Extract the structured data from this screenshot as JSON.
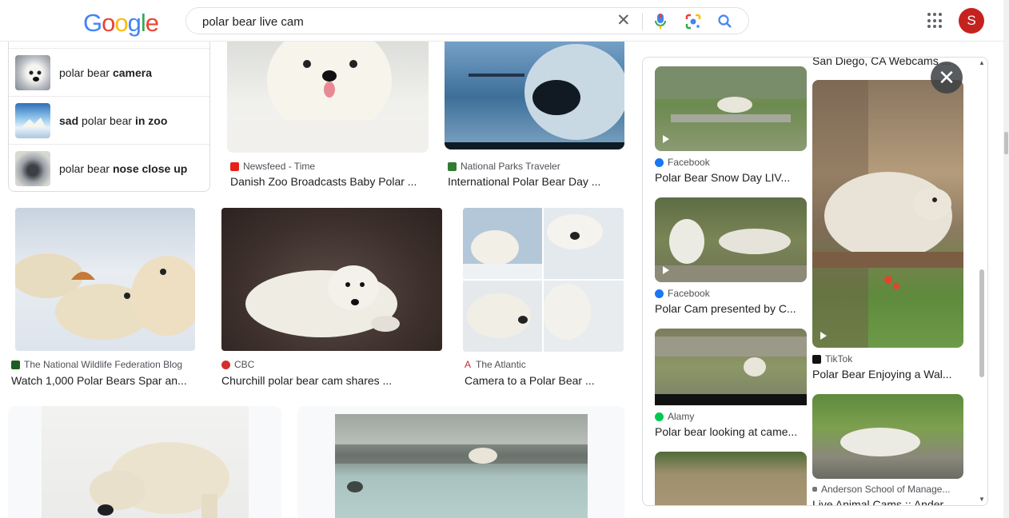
{
  "header": {
    "logo": "Google",
    "query": "polar bear live cam",
    "avatar_letter": "S",
    "icons": [
      "clear-icon",
      "mic-icon",
      "lens-icon",
      "search-icon",
      "apps-icon"
    ]
  },
  "related_searches": [
    {
      "prefix": "polar bear ",
      "bold": "camera",
      "suffix": ""
    },
    {
      "prefix": "",
      "bold": "sad",
      "suffix": " polar bear ",
      "bold2": "in zoo"
    },
    {
      "prefix": "polar bear ",
      "bold": "nose close up",
      "suffix": ""
    }
  ],
  "results": [
    {
      "source": "Newsfeed - Time",
      "title": "Danish Zoo Broadcasts Baby Polar ...",
      "fav_color": "#e62117"
    },
    {
      "source": "National Parks Traveler",
      "title": "International Polar Bear Day ...",
      "fav_color": "#2e7d32"
    },
    {
      "source": "The National Wildlife Federation Blog",
      "title": "Watch 1,000 Polar Bears Spar an...",
      "fav_color": "#1b5e20"
    },
    {
      "source": "CBC",
      "title": "Churchill polar bear cam shares ...",
      "fav_color": "#d32f2f"
    },
    {
      "source": "The Atlantic",
      "title": "Camera to a Polar Bear ...",
      "fav_color": "#c62828"
    }
  ],
  "panel": {
    "top_caption": "San Diego, CA Webcams ...",
    "items": [
      {
        "source": "Facebook",
        "title": "Polar Bear Snow Day LIV...",
        "fav_color": "#1877f2"
      },
      {
        "source": "Facebook",
        "title": "Polar Cam presented by C...",
        "fav_color": "#1877f2"
      },
      {
        "source": "Alamy",
        "title": "Polar bear looking at came...",
        "fav_color": "#00c853"
      },
      {
        "source": "TikTok",
        "title": "Polar Bear Enjoying a Wal...",
        "fav_color": "#111111"
      },
      {
        "source": "Anderson School of Manage...",
        "title": "Live Animal Cams :: Ander...",
        "fav_color": "#777777"
      }
    ],
    "close_label": "✕"
  }
}
